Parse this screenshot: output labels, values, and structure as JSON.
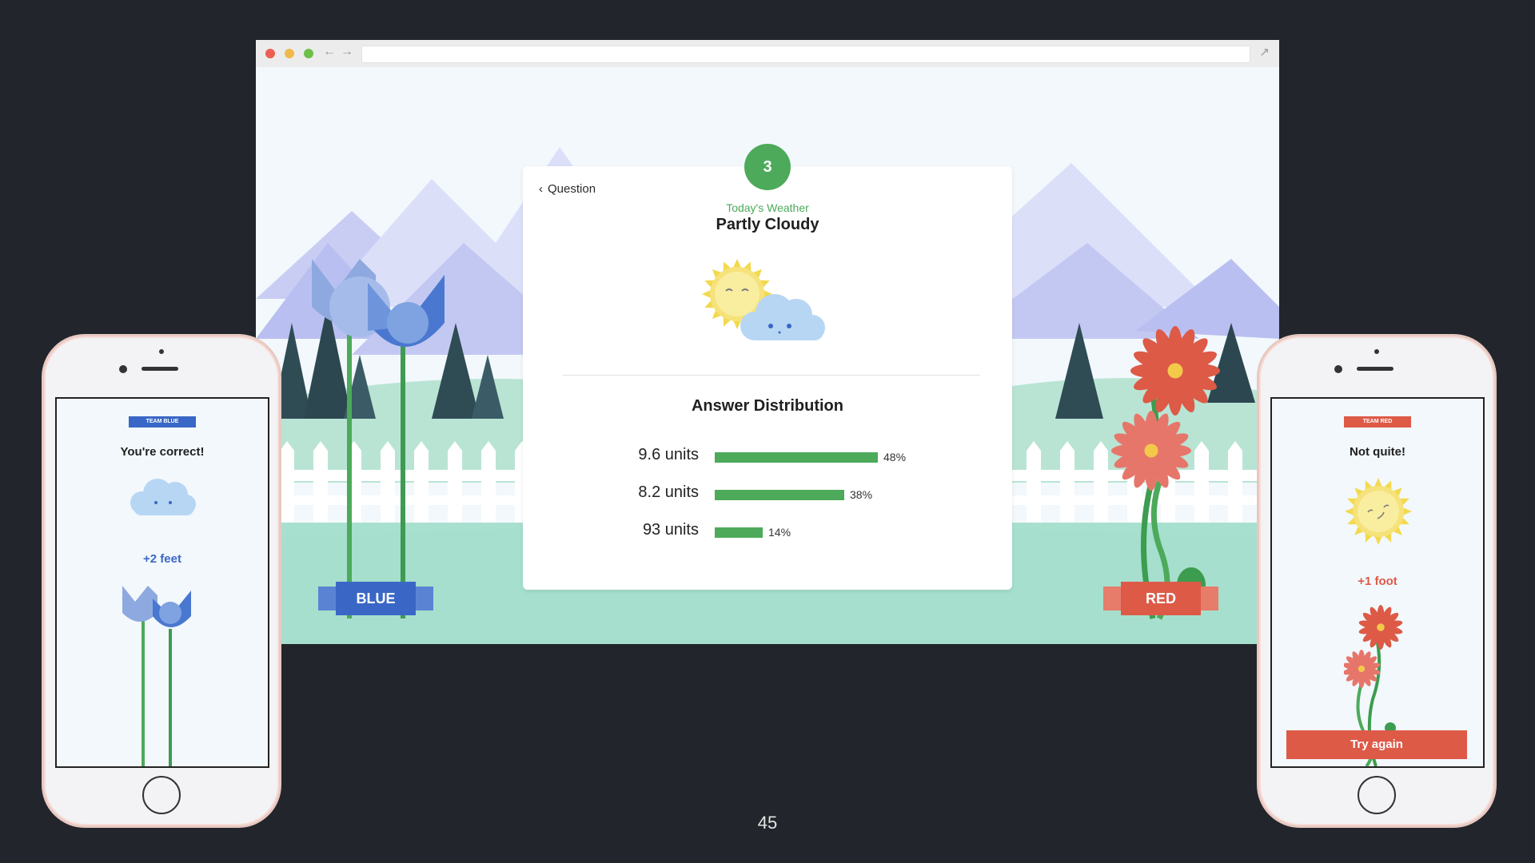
{
  "quiz": {
    "question_number": "3",
    "back_label": "Question",
    "weather_kicker": "Today's Weather",
    "weather_value": "Partly Cloudy",
    "distribution_title": "Answer Distribution",
    "answers": [
      {
        "label": "9.6 units",
        "percent_label": "48%",
        "share": 0.48
      },
      {
        "label": "8.2 units",
        "percent_label": "38%",
        "share": 0.38
      },
      {
        "label": "93 units",
        "percent_label": "14%",
        "share": 0.14
      }
    ]
  },
  "teams": {
    "blue": {
      "label": "BLUE",
      "color": "#3a67c6"
    },
    "red": {
      "label": "RED",
      "color": "#dd5a47"
    }
  },
  "phone_blue": {
    "tag": "TEAM BLUE",
    "title": "You're correct!",
    "gain": "+2 feet",
    "weather_icon": "cloud-icon"
  },
  "phone_red": {
    "tag": "TEAM RED",
    "title": "Not quite!",
    "gain": "+1 foot",
    "button": "Try again",
    "weather_icon": "sun-icon"
  },
  "colors": {
    "green": "#4caa5a",
    "blue": "#3a67c6",
    "red": "#dd5a47",
    "background": "#22252c"
  },
  "page_number": "45"
}
